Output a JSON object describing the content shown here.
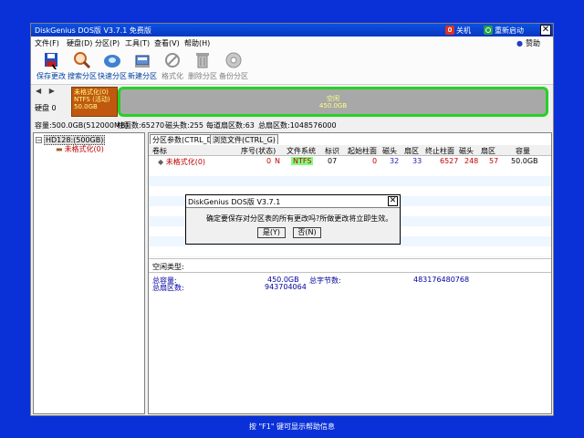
{
  "window": {
    "title": "DiskGenius DOS版 V3.7.1 免费版",
    "shutdown": "关机",
    "restart": "重新启动"
  },
  "menu": {
    "items": [
      "文件(F)",
      "硬盘(D)",
      "分区(P)",
      "工具(T)",
      "查看(V)",
      "帮助(H)"
    ],
    "donate": "赞助"
  },
  "toolbar": {
    "items": [
      {
        "label": "保存更改",
        "icon": "save-icon"
      },
      {
        "label": "搜索分区",
        "icon": "magnifier-icon"
      },
      {
        "label": "快速分区",
        "icon": "disk-icon"
      },
      {
        "label": "新建分区",
        "icon": "new-partition-icon"
      },
      {
        "label": "格式化",
        "icon": "format-icon"
      },
      {
        "label": "删除分区",
        "icon": "trash-icon"
      },
      {
        "label": "备份分区",
        "icon": "backup-icon"
      }
    ]
  },
  "diskmap": {
    "disk_label": "硬盘 0",
    "partition": {
      "name": "未格式化(0)",
      "fs": "NTFS (活动)",
      "size": "50.0GB"
    },
    "free": {
      "name": "空闲",
      "size": "450.0GB"
    }
  },
  "diskinfo": {
    "capacity": "容量:500.0GB(512000MB)",
    "cylinders": "柱面数:65270",
    "heads": "磁头数:255",
    "sectors": "每道扇区数:63",
    "total_sectors": "总扇区数:1048576000"
  },
  "tree": {
    "disk": "HD128:(500GB)",
    "partition": "未格式化(0)"
  },
  "tabs": [
    "分区参数(CTRL_D)",
    "浏览文件(CTRL_G)"
  ],
  "table": {
    "headers": [
      "卷标",
      "序号(状态)",
      "文件系统",
      "标识",
      "起始柱面",
      "磁头",
      "扇区",
      "终止柱面",
      "磁头",
      "扇区",
      "容量"
    ],
    "row": {
      "label": "未格式化(0)",
      "index": "0",
      "status": "N",
      "fs": "NTFS",
      "id": "07",
      "start_cyl": "0",
      "start_head": "32",
      "start_sec": "33",
      "end_cyl": "6527",
      "end_head": "248",
      "end_sec": "57",
      "size": "50.0GB"
    }
  },
  "details": {
    "type_label": "空闲类型:",
    "total_cap_label": "总容量:",
    "total_cap": "450.0GB",
    "total_bytes_label": "总字节数:",
    "total_bytes": "483176480768",
    "total_sectors_label": "总扇区数:",
    "total_sectors": "943704064"
  },
  "dialog": {
    "title": "DiskGenius DOS版 V3.7.1",
    "message": "确定要保存对分区表的所有更改吗?所做更改将立即生效。",
    "yes": "是(Y)",
    "no": "否(N)"
  },
  "status": "按 \"F1\" 键可显示帮助信息",
  "colors": {
    "desktop": "#0a30d8",
    "partition": "#c05810",
    "free_border": "#28d028",
    "title_bar": "#0838c0"
  }
}
